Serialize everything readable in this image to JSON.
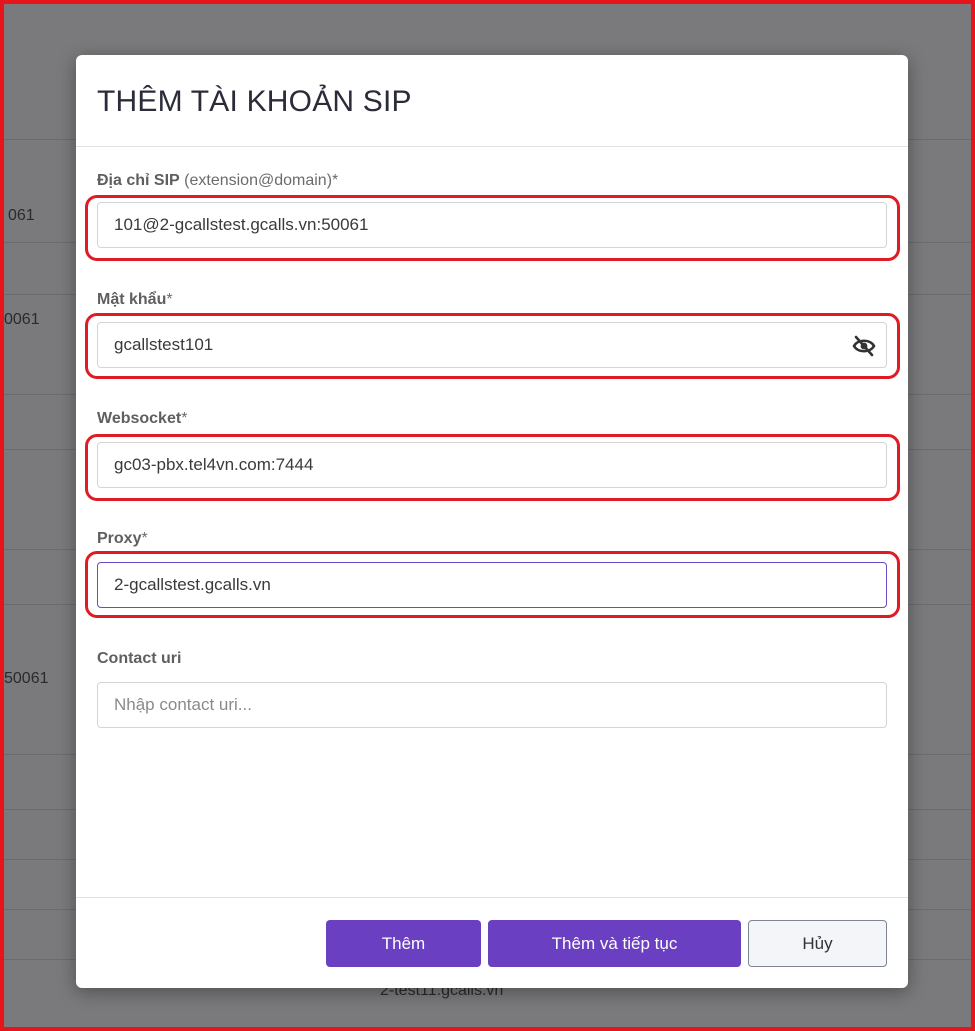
{
  "background": {
    "fragments": [
      "061",
      "0061",
      "50061",
      "2-test11.gcalls.vn"
    ]
  },
  "modal": {
    "title": "THÊM TÀI KHOẢN SIP",
    "fields": {
      "sip_address": {
        "label": "Địa chỉ SIP",
        "hint": "(extension@domain)*",
        "value": "101@2-gcallstest.gcalls.vn:50061"
      },
      "password": {
        "label": "Mật khẩu",
        "required": "*",
        "value": "gcallstest101",
        "toggle_icon": "eye-off-icon"
      },
      "websocket": {
        "label": "Websocket",
        "required": "*",
        "value": "gc03-pbx.tel4vn.com:7444"
      },
      "proxy": {
        "label": "Proxy",
        "required": "*",
        "value": "2-gcallstest.gcalls.vn"
      },
      "contact_uri": {
        "label": "Contact uri",
        "placeholder": "Nhập contact uri..."
      }
    },
    "buttons": {
      "add": "Thêm",
      "add_continue": "Thêm và tiếp tục",
      "cancel": "Hủy"
    }
  },
  "colors": {
    "primary": "#6a3fc2",
    "highlight": "#e01b24",
    "overlay": "#7a7a7c"
  }
}
